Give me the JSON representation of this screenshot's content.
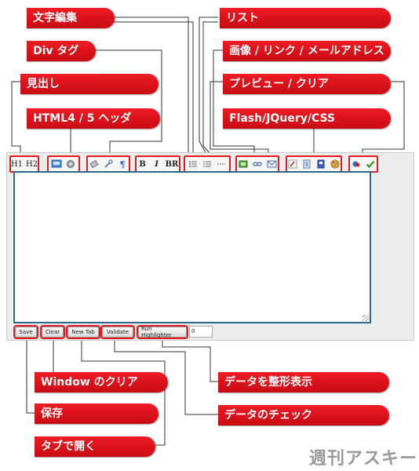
{
  "labels": {
    "text_edit": "文字編集",
    "div_tag": "Div タグ",
    "heading": "見出し",
    "html_header": "HTML4 / 5 ヘッダ",
    "list": "リスト",
    "image_link_mail": "画像 / リンク / メールアドレス",
    "preview_clear": "プレビュー / クリア",
    "flash_jquery_css": "Flash/JQuery/CSS",
    "window_clear": "Window のクリア",
    "save": "保存",
    "open_tab": "タブで開く",
    "format_display": "データを整形表示",
    "data_check": "データのチェック"
  },
  "toolbar": {
    "h1": "H1",
    "h2": "H2",
    "bold": "B",
    "italic": "I",
    "br": "BR"
  },
  "buttons": {
    "save": "Save",
    "clear": "Clear",
    "new_tab": "New Tab",
    "validate": "Validate",
    "run_highlighter": "Run Highlighter",
    "counter_value": "0"
  },
  "watermark": "週刊アスキー",
  "colors": {
    "label_red": "#e21a22",
    "textarea_border": "#2d6a8f"
  }
}
